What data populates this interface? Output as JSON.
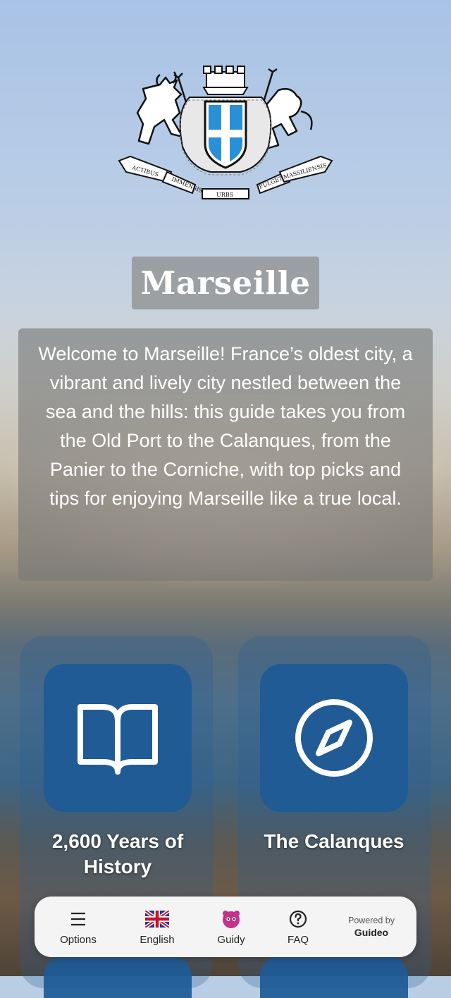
{
  "city": {
    "title": "Marseille",
    "intro": "Welcome to Marseille! France’s oldest city, a vibrant and lively city nestled between the sea and the hills: this guide takes you from the Old Port to the Calanques, from the Panier to the Corniche, with top picks and tips for enjoying Marseille like a true local."
  },
  "crest": {
    "motto_words": [
      "ACTIBUS",
      "IMMENSIS",
      "URBS",
      "FULGET",
      "MASSILIENSIS"
    ]
  },
  "tiles": [
    {
      "label": "2,600 Years of History",
      "icon": "book-icon"
    },
    {
      "label": "The Calanques",
      "icon": "compass-icon"
    }
  ],
  "nav": {
    "options_label": "Options",
    "language_label": "English",
    "guidy_label": "Guidy",
    "faq_label": "FAQ",
    "powered_by": "Powered by",
    "brand": "Guideo"
  },
  "colors": {
    "tile": "#1e5a96",
    "navbar": "#f4f4f4",
    "crest_blue": "#2a8fd6"
  }
}
